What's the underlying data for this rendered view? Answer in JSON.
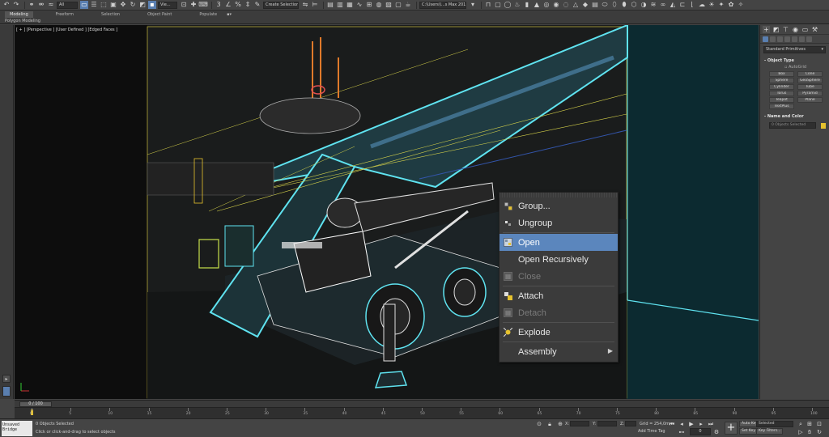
{
  "toolbar": {
    "viewport_combo": "Vie...",
    "selection_set_combo": "Create Selection Se",
    "workspace_combo": "C:\\Users\\l...s Max 2016"
  },
  "ribbon": {
    "tabs": [
      "Modeling",
      "Freeform",
      "Selection",
      "Object Paint",
      "Populate"
    ],
    "active_tab": 0,
    "subpanel": "Polygon Modeling"
  },
  "viewport": {
    "label": "[ + ] [Perspective ] [User Defined ] [Edged Faces ]"
  },
  "context_menu": {
    "items": [
      {
        "label": "Group...",
        "icon": "group-icon",
        "enabled": true
      },
      {
        "label": "Ungroup",
        "icon": "ungroup-icon",
        "enabled": true
      },
      {
        "label": "Open",
        "icon": "open-group-icon",
        "enabled": true,
        "highlighted": true
      },
      {
        "label": "Open Recursively",
        "icon": "",
        "enabled": true
      },
      {
        "label": "Close",
        "icon": "close-group-icon",
        "enabled": false
      },
      {
        "label": "Attach",
        "icon": "attach-icon",
        "enabled": true
      },
      {
        "label": "Detach",
        "icon": "detach-icon",
        "enabled": false
      },
      {
        "label": "Explode",
        "icon": "explode-icon",
        "enabled": true
      },
      {
        "label": "Assembly",
        "icon": "",
        "enabled": true,
        "submenu": true
      }
    ]
  },
  "command_panel": {
    "category": "Standard Primitives",
    "object_type_title": "Object Type",
    "autogrid": "AutoGrid",
    "object_buttons": [
      "Box",
      "Cone",
      "Sphere",
      "GeoSphere",
      "Cylinder",
      "Tube",
      "Torus",
      "Pyramid",
      "Teapot",
      "Plane",
      "TextPlus"
    ],
    "name_color_title": "Name and Color",
    "name_placeholder": "0 Objects Selected",
    "swatch_color": "#e6c22e"
  },
  "timeline": {
    "slider_label": "0 / 100",
    "ticks": [
      "0",
      "5",
      "10",
      "15",
      "20",
      "25",
      "30",
      "35",
      "40",
      "45",
      "50",
      "55",
      "60",
      "65",
      "70",
      "75",
      "80",
      "85",
      "90",
      "95",
      "100"
    ]
  },
  "status_bar": {
    "maxscript_text": "Unsaved Bridge",
    "selection_status": "0 Objects Selected",
    "prompt": "Click or click-and-drag to select objects",
    "x_label": "X:",
    "y_label": "Y:",
    "z_label": "Z:",
    "grid": "Grid = 254,0mm",
    "add_time_tag": "Add Time Tag",
    "auto_key": "Auto Key",
    "set_key": "Set Key",
    "selected_combo": "Selected",
    "key_filters": "Key Filters...",
    "current_frame": "0"
  },
  "colors": {
    "highlight": "#5b86bd",
    "wire_cyan": "#5fe3f0",
    "wire_yellow": "#d6d24a",
    "key_yellow": "#e6c22e"
  }
}
